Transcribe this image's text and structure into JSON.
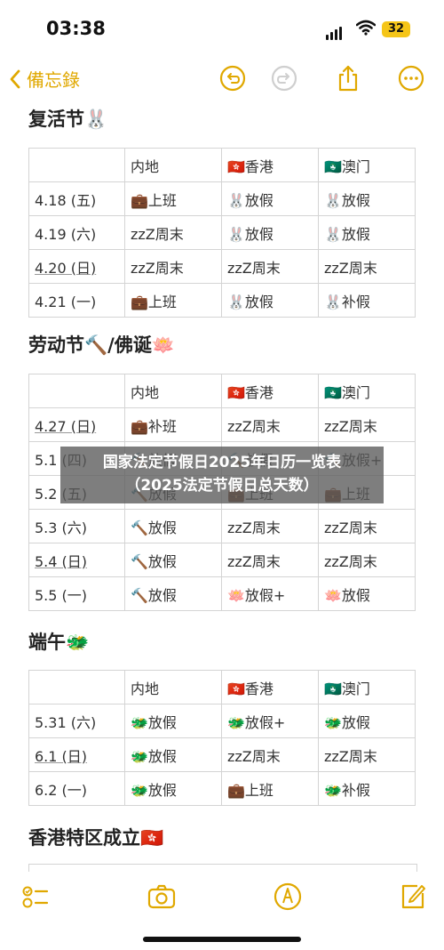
{
  "status_bar": {
    "time": "03:38",
    "battery": "32"
  },
  "nav": {
    "back_label": "備忘錄"
  },
  "sections": [
    {
      "title": "复活节🐰",
      "header": [
        "",
        "内地",
        "🇭🇰香港",
        "🇲🇴澳门"
      ],
      "rows": [
        [
          "4.18 (五)",
          "💼上班",
          "🐰放假",
          "🐰放假"
        ],
        [
          "4.19 (六)",
          "zzZ周末",
          "🐰放假",
          "🐰放假"
        ],
        [
          "4.20 (日)",
          "zzZ周末",
          "zzZ周末",
          "zzZ周末"
        ],
        [
          "4.21 (一)",
          "💼上班",
          "🐰放假",
          "🐰补假"
        ]
      ]
    },
    {
      "title": "劳动节🔨/佛诞🪷",
      "header": [
        "",
        "内地",
        "🇭🇰香港",
        "🇲🇴澳门"
      ],
      "rows": [
        [
          "4.27 (日)",
          "💼补班",
          "zzZ周末",
          "zzZ周末"
        ],
        [
          "5.1 (四)",
          "🔨放假",
          "🔨放假",
          "🔨放假+"
        ],
        [
          "5.2 (五)",
          "🔨放假",
          "💼上班",
          "💼上班"
        ],
        [
          "5.3 (六)",
          "🔨放假",
          "zzZ周末",
          "zzZ周末"
        ],
        [
          "5.4 (日)",
          "🔨放假",
          "zzZ周末",
          "zzZ周末"
        ],
        [
          "5.5 (一)",
          "🔨放假",
          "🪷放假+",
          "🪷放假"
        ]
      ]
    },
    {
      "title": "端午🐲",
      "header": [
        "",
        "内地",
        "🇭🇰香港",
        "🇲🇴澳门"
      ],
      "rows": [
        [
          "5.31 (六)",
          "🐲放假",
          "🐲放假+",
          "🐲放假"
        ],
        [
          "6.1 (日)",
          "🐲放假",
          "zzZ周末",
          "zzZ周末"
        ],
        [
          "6.2 (一)",
          "🐲放假",
          "💼上班",
          "🐲补假"
        ]
      ]
    },
    {
      "title": "香港特区成立🇭🇰"
    }
  ],
  "watermark": {
    "line1": "国家法定节假日2025年日历一览表",
    "line2": "（2025法定节假日总天数）"
  },
  "colors": {
    "accent": "#e0a800",
    "zz": "#2b5fd9"
  }
}
